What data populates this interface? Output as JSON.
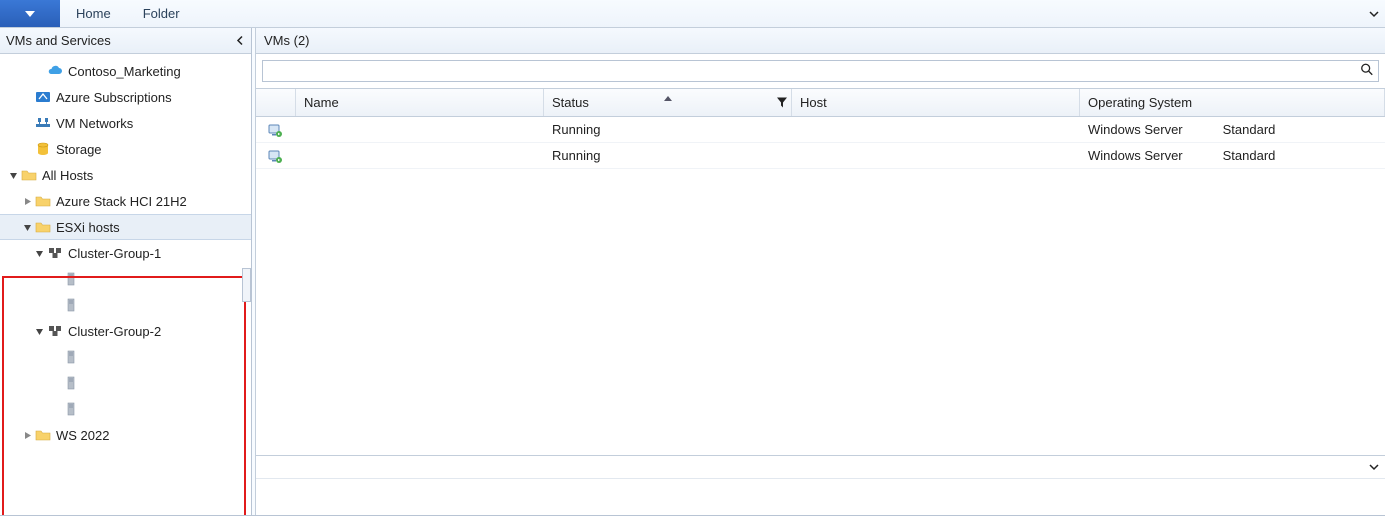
{
  "ribbon": {
    "tabs": [
      "Home",
      "Folder"
    ]
  },
  "nav": {
    "title": "VMs and Services",
    "items": [
      {
        "label": "Contoso_Marketing",
        "icon": "cloud",
        "indent": 2,
        "twisty": "none"
      },
      {
        "label": "Azure Subscriptions",
        "icon": "azure",
        "indent": 1,
        "twisty": "none"
      },
      {
        "label": "VM Networks",
        "icon": "network",
        "indent": 1,
        "twisty": "none"
      },
      {
        "label": "Storage",
        "icon": "storage",
        "indent": 1,
        "twisty": "none"
      },
      {
        "label": "All Hosts",
        "icon": "folder",
        "indent": 0,
        "twisty": "expanded"
      },
      {
        "label": "Azure Stack HCI 21H2",
        "icon": "folder",
        "indent": 1,
        "twisty": "collapsed"
      },
      {
        "label": "ESXi hosts",
        "icon": "folder",
        "indent": 1,
        "twisty": "expanded",
        "selected": true
      },
      {
        "label": "Cluster-Group-1",
        "icon": "cluster",
        "indent": 2,
        "twisty": "expanded"
      },
      {
        "label": "",
        "icon": "host",
        "indent": 3,
        "twisty": "none"
      },
      {
        "label": "",
        "icon": "host",
        "indent": 3,
        "twisty": "none"
      },
      {
        "label": "Cluster-Group-2",
        "icon": "cluster",
        "indent": 2,
        "twisty": "expanded"
      },
      {
        "label": "",
        "icon": "host",
        "indent": 3,
        "twisty": "none"
      },
      {
        "label": "",
        "icon": "host",
        "indent": 3,
        "twisty": "none"
      },
      {
        "label": "",
        "icon": "host",
        "indent": 3,
        "twisty": "none"
      },
      {
        "label": "WS 2022",
        "icon": "folder",
        "indent": 1,
        "twisty": "collapsed"
      }
    ]
  },
  "content": {
    "title": "VMs (2)",
    "search_placeholder": "",
    "columns": {
      "name": "Name",
      "status": "Status",
      "host": "Host",
      "os": "Operating System"
    },
    "rows": [
      {
        "name": "",
        "status": "Running",
        "host": "",
        "os": "Windows Server",
        "os_extra": "Standard"
      },
      {
        "name": "",
        "status": "Running",
        "host": "",
        "os": "Windows Server",
        "os_extra": "Standard"
      }
    ]
  }
}
